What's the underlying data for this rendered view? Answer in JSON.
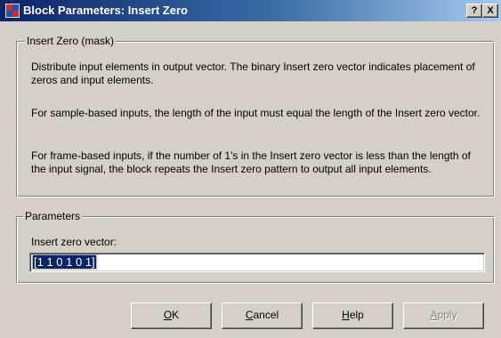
{
  "window": {
    "title": "Block Parameters: Insert Zero",
    "help_button": "?",
    "close_button": "X"
  },
  "mask_group": {
    "legend": "Insert Zero (mask)",
    "descriptions": [
      "Distribute input elements in output vector. The binary Insert zero vector indicates placement of zeros and input elements.",
      "For sample-based inputs, the length of the input must equal the length of the Insert zero vector.",
      "For frame-based inputs, if the number of 1's in the Insert zero vector is less than the length of the input signal, the block repeats the Insert zero pattern to output all input elements."
    ]
  },
  "parameters_group": {
    "legend": "Parameters",
    "insert_zero_label": "Insert zero vector:",
    "insert_zero_value": "[1 1 0 1 0 1]"
  },
  "buttons": {
    "ok": {
      "mnemonic": "O",
      "rest": "K"
    },
    "cancel": {
      "mnemonic": "C",
      "rest": "ancel"
    },
    "help": {
      "mnemonic": "H",
      "rest": "elp"
    },
    "apply": {
      "mnemonic": "A",
      "rest": "pply",
      "enabled": false
    }
  },
  "icons": {
    "title_icon": "simulink-block-icon"
  }
}
